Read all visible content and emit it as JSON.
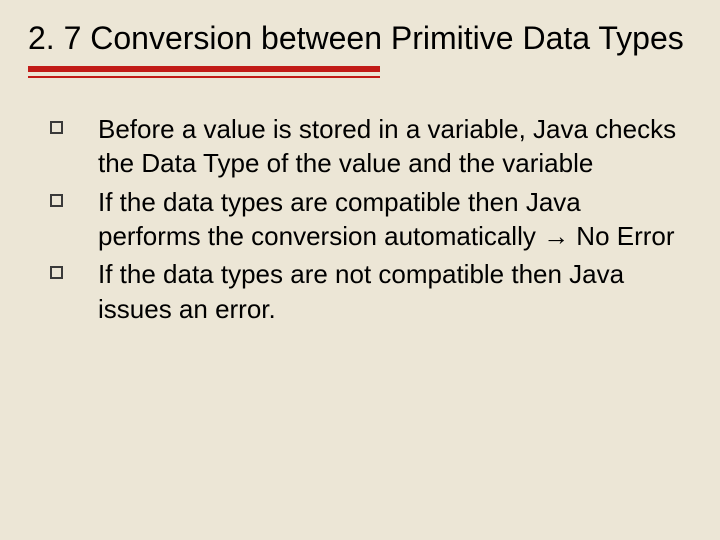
{
  "slide": {
    "title": "2. 7 Conversion between Primitive Data Types",
    "bullets": [
      {
        "text": "Before a value is stored in a variable, Java checks the Data Type of the value and the variable"
      },
      {
        "text": "If the data types are compatible then Java performs the conversion automatically → No Error"
      },
      {
        "text": "If the data types are not compatible then Java issues an error."
      }
    ]
  }
}
